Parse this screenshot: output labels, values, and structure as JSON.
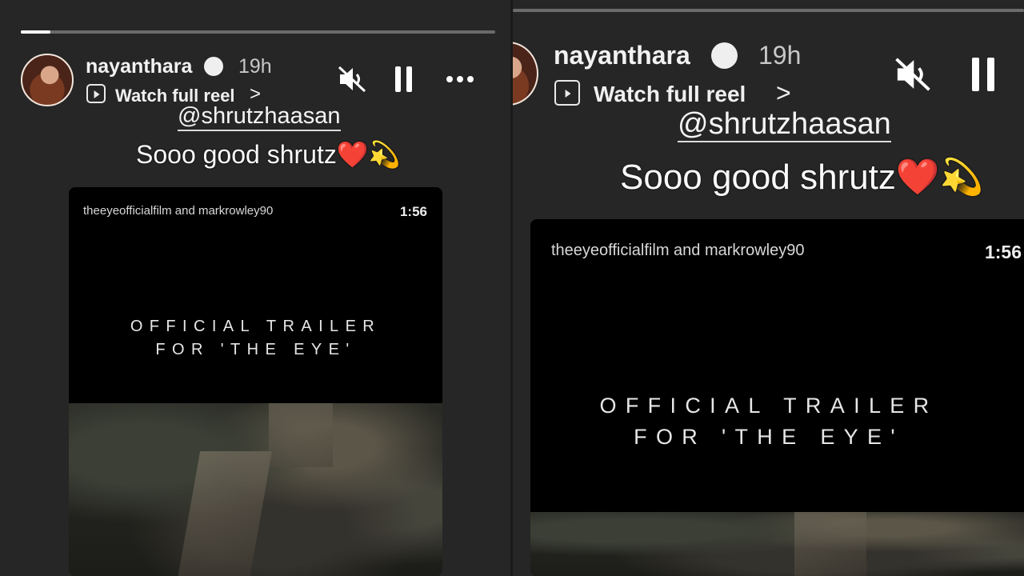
{
  "story": {
    "username": "nayanthara",
    "time_ago": "19h",
    "reel_link": "Watch full reel",
    "chevron": ">",
    "mention": "@shrutzhaasan",
    "caption_text": "Sooo good shrutz",
    "caption_heart": "❤️",
    "caption_spark": "💫",
    "progress_fraction": 0.06
  },
  "card": {
    "authors": "theeyeofficialfilm and markrowley90",
    "duration": "1:56",
    "title_line1": "OFFICIAL TRAILER",
    "title_line2": "FOR 'THE EYE'"
  },
  "icons": [
    "verified-badge-icon",
    "reel-icon",
    "chevron-right-icon",
    "mute-icon",
    "pause-icon",
    "more-icon"
  ],
  "colors": {
    "background": "#262626",
    "card": "#000000",
    "heart": "#e0202b"
  }
}
